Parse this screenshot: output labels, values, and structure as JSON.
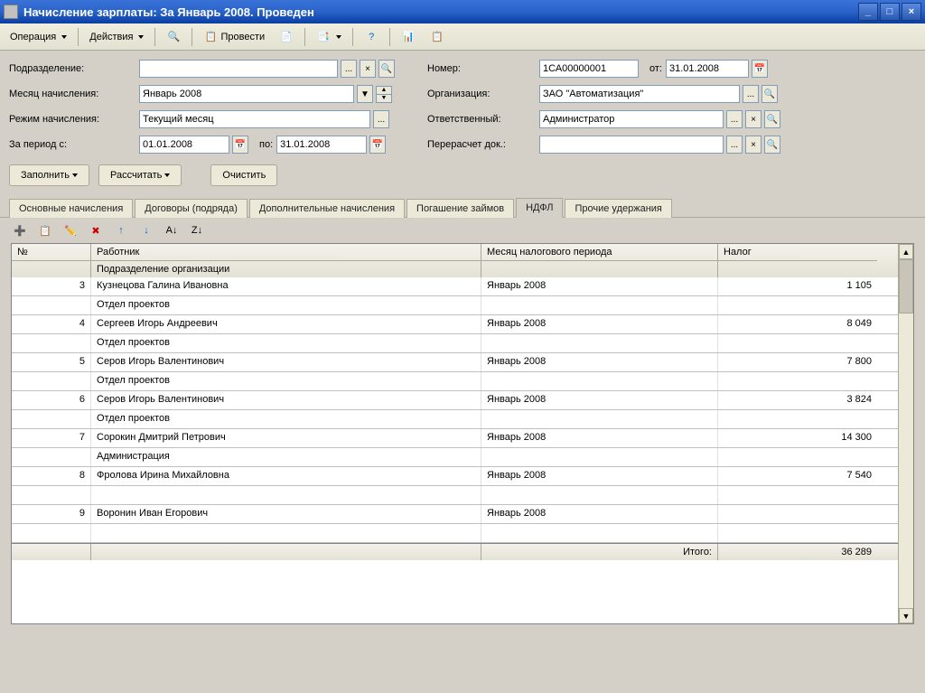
{
  "window": {
    "title": "Начисление зарплаты: За Январь 2008. Проведен"
  },
  "toolbar": {
    "operation": "Операция",
    "actions": "Действия",
    "post": "Провести"
  },
  "form": {
    "left": {
      "department_label": "Подразделение:",
      "department_value": "",
      "month_label": "Месяц начисления:",
      "month_value": "Январь 2008",
      "mode_label": "Режим начисления:",
      "mode_value": "Текущий месяц",
      "period_from_label": "За период с:",
      "period_from_value": "01.01.2008",
      "period_to_label": "по:",
      "period_to_value": "31.01.2008"
    },
    "right": {
      "number_label": "Номер:",
      "number_value": "1СА00000001",
      "date_label": "от:",
      "date_value": "31.01.2008",
      "org_label": "Организация:",
      "org_value": "ЗАО \"Автоматизация\"",
      "responsible_label": "Ответственный:",
      "responsible_value": "Администратор",
      "recalc_label": "Перерасчет док.:",
      "recalc_value": ""
    }
  },
  "actions": {
    "fill": "Заполнить",
    "calc": "Рассчитать",
    "clear": "Очистить"
  },
  "tabs": {
    "main": "Основные начисления",
    "contracts": "Договоры (подряда)",
    "additional": "Дополнительные начисления",
    "loans": "Погашение займов",
    "ndfl": "НДФЛ",
    "other": "Прочие удержания"
  },
  "grid": {
    "headers": {
      "num": "№",
      "employee": "Работник",
      "dept": "Подразделение организации",
      "month": "Месяц налогового периода",
      "tax": "Налог"
    },
    "rows": [
      {
        "num": "3",
        "employee": "Кузнецова Галина Ивановна",
        "dept": "Отдел проектов",
        "month": "Январь 2008",
        "tax": "1 105"
      },
      {
        "num": "4",
        "employee": "Сергеев Игорь Андреевич",
        "dept": "Отдел проектов",
        "month": "Январь 2008",
        "tax": "8 049"
      },
      {
        "num": "5",
        "employee": "Серов Игорь Валентинович",
        "dept": "Отдел проектов",
        "month": "Январь 2008",
        "tax": "7 800"
      },
      {
        "num": "6",
        "employee": "Серов Игорь Валентинович",
        "dept": "Отдел проектов",
        "month": "Январь 2008",
        "tax": "3 824"
      },
      {
        "num": "7",
        "employee": "Сорокин Дмитрий Петрович",
        "dept": "Администрация",
        "month": "Январь 2008",
        "tax": "14 300"
      },
      {
        "num": "8",
        "employee": "Фролова Ирина Михайловна",
        "dept": "",
        "month": "Январь 2008",
        "tax": "7 540"
      },
      {
        "num": "9",
        "employee": "Воронин Иван Егорович",
        "dept": "",
        "month": "Январь 2008",
        "tax": ""
      }
    ],
    "footer": {
      "total_label": "Итого:",
      "total_value": "36 289"
    }
  }
}
